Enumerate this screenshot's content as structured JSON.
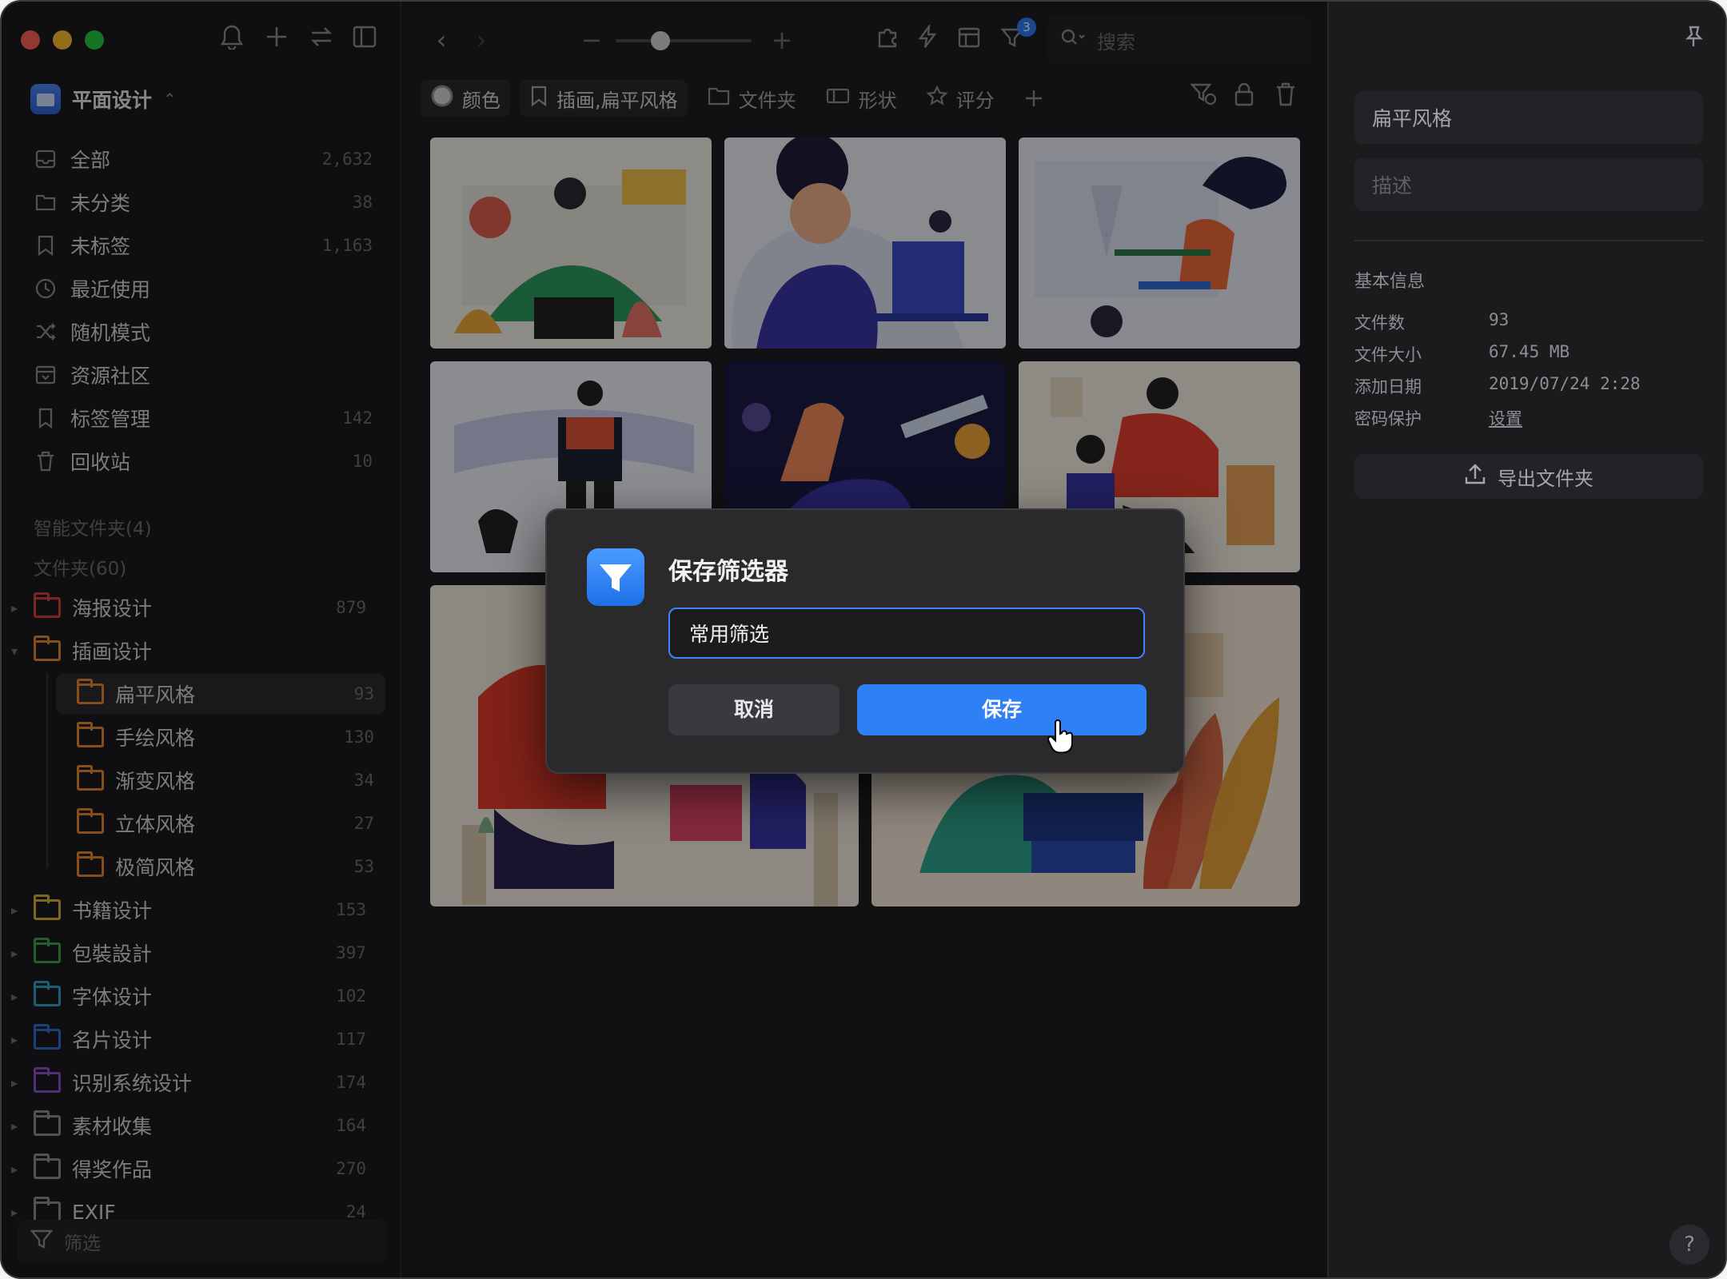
{
  "sidebar": {
    "library_name": "平面设计",
    "nav": [
      {
        "label": "全部",
        "count": "2,632",
        "icon": "inbox-icon"
      },
      {
        "label": "未分类",
        "count": "38",
        "icon": "unsorted-folder-icon"
      },
      {
        "label": "未标签",
        "count": "1,163",
        "icon": "untagged-icon"
      },
      {
        "label": "最近使用",
        "count": "",
        "icon": "clock-icon"
      },
      {
        "label": "随机模式",
        "count": "",
        "icon": "shuffle-icon"
      },
      {
        "label": "资源社区",
        "count": "",
        "icon": "community-icon"
      },
      {
        "label": "标签管理",
        "count": "142",
        "icon": "bookmark-icon"
      },
      {
        "label": "回收站",
        "count": "10",
        "icon": "trash-icon"
      }
    ],
    "smart_folders_label": "智能文件夹(4)",
    "folders_label": "文件夹(60)",
    "folders": [
      {
        "label": "海报设计",
        "count": "879",
        "color": "#d8413b",
        "expanded": false
      },
      {
        "label": "插画设计",
        "count": "",
        "color": "#e3892d",
        "expanded": true
      },
      {
        "label": "扁平风格",
        "count": "93",
        "color": "#e3892d",
        "child": true
      },
      {
        "label": "手绘风格",
        "count": "130",
        "color": "#e3892d",
        "child": true
      },
      {
        "label": "渐变风格",
        "count": "34",
        "color": "#e3892d",
        "child": true
      },
      {
        "label": "立体风格",
        "count": "27",
        "color": "#e3892d",
        "child": true
      },
      {
        "label": "极简风格",
        "count": "53",
        "color": "#e3892d",
        "child": true
      },
      {
        "label": "书籍设计",
        "count": "153",
        "color": "#d8b237",
        "expanded": false
      },
      {
        "label": "包裝設計",
        "count": "397",
        "color": "#3fa34d",
        "expanded": false
      },
      {
        "label": "字体设计",
        "count": "102",
        "color": "#2ea0c8",
        "expanded": false
      },
      {
        "label": "名片设计",
        "count": "117",
        "color": "#2f6fd6",
        "expanded": false
      },
      {
        "label": "识别系统设计",
        "count": "174",
        "color": "#8a52c8",
        "expanded": false
      },
      {
        "label": "素材收集",
        "count": "164",
        "color": "#8e8e93",
        "expanded": false
      },
      {
        "label": "得奖作品",
        "count": "270",
        "color": "#8e8e93",
        "expanded": false
      },
      {
        "label": "EXIF",
        "count": "24",
        "color": "#8e8e93",
        "expanded": false
      }
    ],
    "filter_placeholder": "筛选"
  },
  "toolbar": {
    "search_placeholder": "搜索",
    "filter_badge": "3",
    "zoom_level": 0.3
  },
  "filter_chips": [
    {
      "label": "颜色",
      "icon": "color-circle-icon",
      "on": true
    },
    {
      "label": "插画,扁平风格",
      "icon": "bookmark-icon",
      "on": true
    },
    {
      "label": "文件夹",
      "icon": "folder-icon",
      "on": false
    },
    {
      "label": "形状",
      "icon": "shape-icon",
      "on": false
    },
    {
      "label": "评分",
      "icon": "star-icon",
      "on": false
    }
  ],
  "dialog": {
    "title": "保存筛选器",
    "input_value": "常用筛选",
    "cancel_label": "取消",
    "save_label": "保存"
  },
  "inspector": {
    "name_value": "扁平风格",
    "description_placeholder": "描述",
    "section_title": "基本信息",
    "rows": [
      {
        "key": "文件数",
        "value": "93"
      },
      {
        "key": "文件大小",
        "value": "67.45 MB"
      },
      {
        "key": "添加日期",
        "value": "2019/07/24 2:28"
      },
      {
        "key": "密码保护",
        "value": "设置"
      }
    ],
    "export_label": "导出文件夹"
  },
  "colors": {
    "accent": "#2f80f6",
    "traffic_red": "#fe5f57",
    "traffic_yellow": "#febc2e",
    "traffic_green": "#28c840"
  }
}
